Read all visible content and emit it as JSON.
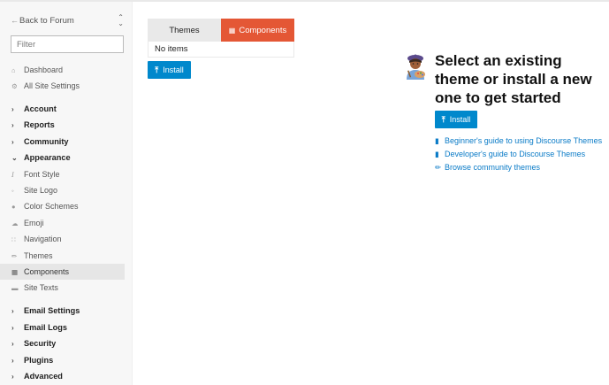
{
  "sidebar": {
    "back_label": "Back to Forum",
    "filter_placeholder": "Filter",
    "items": [
      {
        "label": "Dashboard",
        "icon": "home-icon",
        "section": false
      },
      {
        "label": "All Site Settings",
        "icon": "gear-icon",
        "section": false
      },
      {
        "label": "Account",
        "icon": "chevron-right-icon",
        "section": true
      },
      {
        "label": "Reports",
        "icon": "chevron-right-icon",
        "section": true
      },
      {
        "label": "Community",
        "icon": "chevron-right-icon",
        "section": true
      },
      {
        "label": "Appearance",
        "icon": "chevron-down-icon",
        "section": true
      },
      {
        "label": "Font Style",
        "icon": "italic-icon",
        "section": false
      },
      {
        "label": "Site Logo",
        "icon": "image-icon",
        "section": false
      },
      {
        "label": "Color Schemes",
        "icon": "palette-icon",
        "section": false
      },
      {
        "label": "Emoji",
        "icon": "emoji-icon",
        "section": false
      },
      {
        "label": "Navigation",
        "icon": "route-icon",
        "section": false
      },
      {
        "label": "Themes",
        "icon": "paintbrush-icon",
        "section": false
      },
      {
        "label": "Components",
        "icon": "puzzle-icon",
        "section": false,
        "active": true
      },
      {
        "label": "Site Texts",
        "icon": "text-icon",
        "section": false
      },
      {
        "label": "Email Settings",
        "icon": "chevron-right-icon",
        "section": true
      },
      {
        "label": "Email Logs",
        "icon": "chevron-right-icon",
        "section": true
      },
      {
        "label": "Security",
        "icon": "chevron-right-icon",
        "section": true
      },
      {
        "label": "Plugins",
        "icon": "chevron-right-icon",
        "section": true
      },
      {
        "label": "Advanced",
        "icon": "chevron-right-icon",
        "section": true
      }
    ]
  },
  "main": {
    "tabs": [
      {
        "label": "Themes"
      },
      {
        "label": "Components"
      }
    ],
    "empty_text": "No items",
    "install_label": "Install"
  },
  "welcome": {
    "title": "Select an existing theme or install a new one to get started",
    "install_label": "Install",
    "links": [
      {
        "label": "Beginner's guide to using Discourse Themes",
        "icon": "book-icon"
      },
      {
        "label": "Developer's guide to Discourse Themes",
        "icon": "book-icon"
      },
      {
        "label": "Browse community themes",
        "icon": "paintbrush-icon"
      }
    ]
  },
  "colors": {
    "accent": "#0088cc",
    "active_tab": "#e45735",
    "sidebar_bg": "#f7f7f7"
  }
}
